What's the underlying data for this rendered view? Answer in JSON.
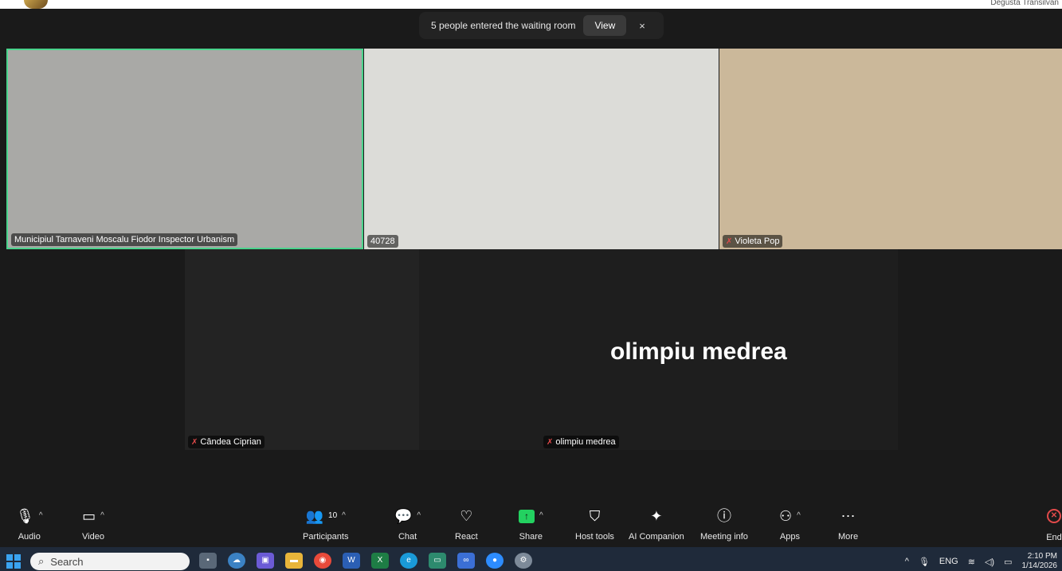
{
  "header": {
    "brand_text": "Degusta Transilvan"
  },
  "notification": {
    "text": "5 people entered the waiting room",
    "view_label": "View",
    "close_label": "×"
  },
  "tiles": {
    "t1_name": "Municipiul Tarnaveni Moscalu Fiodor Inspector Urbanism",
    "t2_name": "40728",
    "t3_name": "Violeta Pop",
    "t4_name": "Cândea Ciprian",
    "t5_name": "olimpiu medrea",
    "t5_big": "olimpiu medrea"
  },
  "toolbar": {
    "audio": "Audio",
    "video": "Video",
    "participants": "Participants",
    "participants_count": "10",
    "chat": "Chat",
    "react": "React",
    "share": "Share",
    "host_tools": "Host tools",
    "ai_companion": "AI Companion",
    "meeting_info": "Meeting info",
    "apps": "Apps",
    "more": "More",
    "end": "End"
  },
  "taskbar": {
    "search_placeholder": "Search",
    "lang": "ENG",
    "time": "2:10 PM",
    "date": "1/14/2026"
  },
  "colors": {
    "active_speaker": "#4ad38c",
    "share": "#23d160",
    "end": "#e24a4a"
  }
}
